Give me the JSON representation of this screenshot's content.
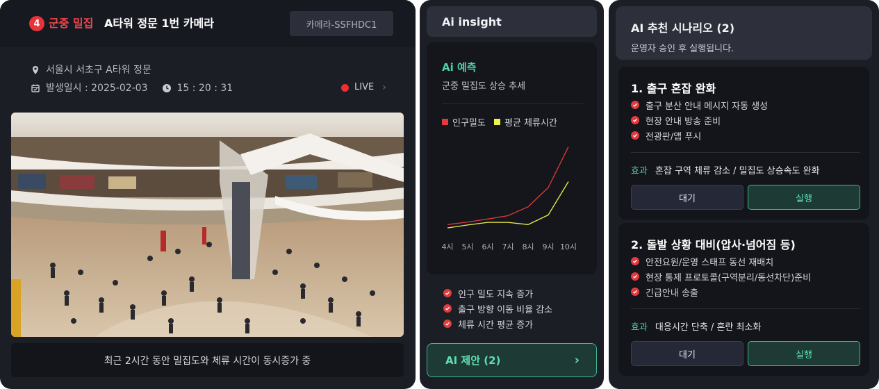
{
  "camera_panel": {
    "alert_count": "4",
    "alert_type": "군중 밀집",
    "camera_title": "A타워 정문 1번 카메라",
    "camera_id": "카메라-SSFHDC1",
    "location": "서울시 서초구 A타워 정문",
    "date_label": "발생일시 : 2025-02-03",
    "time": "15 : 20 : 31",
    "live_label": "LIVE",
    "caption": "최근 2시간 동안 밀집도와 체류 시간이 동시증가 중",
    "colors": {
      "alert": "#e8333a",
      "live": "#ee2e33"
    }
  },
  "insight_panel": {
    "title": "Ai insight",
    "prediction_title": "Ai 예측",
    "prediction_subtitle": "군중 밀집도 상승 추세",
    "legend": [
      "인구밀도",
      "평균 체류시간"
    ],
    "insights": [
      "인구 밀도 지속 증가",
      "출구 방향 이동 비율 감소",
      "체류 시간 평균 증가"
    ],
    "ai_button_label": "AI 제안 (2)",
    "colors": {
      "accent": "#4fd1a5",
      "density": "#e03a3a",
      "dwell": "#f2f04a"
    }
  },
  "chart_data": {
    "type": "line",
    "x": [
      "4시",
      "5시",
      "6시",
      "7시",
      "8시",
      "9시",
      "10시"
    ],
    "series": [
      {
        "name": "인구밀도",
        "values": [
          1.0,
          1.35,
          1.75,
          2.2,
          3.4,
          6.0,
          11.5
        ]
      },
      {
        "name": "평균 체류시간",
        "values": [
          0.55,
          0.95,
          1.3,
          1.3,
          1.0,
          2.3,
          6.8
        ]
      }
    ],
    "ylim": [
      0,
      12
    ],
    "title": "",
    "xlabel": "",
    "ylabel": "",
    "grid": false,
    "legend_position": "top-left"
  },
  "scenario_panel": {
    "title": "AI 추천 시나리오 (2)",
    "subtitle": "운영자 승인 후 실행됩니다.",
    "scenarios": [
      {
        "title": "1. 출구 혼잡 완화",
        "items": [
          "출구 분산 안내 메시지 자동 생성",
          "현장 안내 방송 준비",
          "전광판/앱 푸시"
        ],
        "effect_label": "효과",
        "effect": "혼잡 구역 체류 감소 / 밀집도 상승속도 완화",
        "wait_label": "대기",
        "run_label": "실행"
      },
      {
        "title": "2. 돌발 상황 대비(압사·넘어짐 등)",
        "items": [
          "안전요원/운영 스태프 동선 재배치",
          "현장 통제 프로토콜(구역분리/동선차단)준비",
          "긴급안내 송출"
        ],
        "effect_label": "효과",
        "effect": "대응시간 단축 / 혼란 최소화",
        "wait_label": "대기",
        "run_label": "실행"
      }
    ]
  }
}
